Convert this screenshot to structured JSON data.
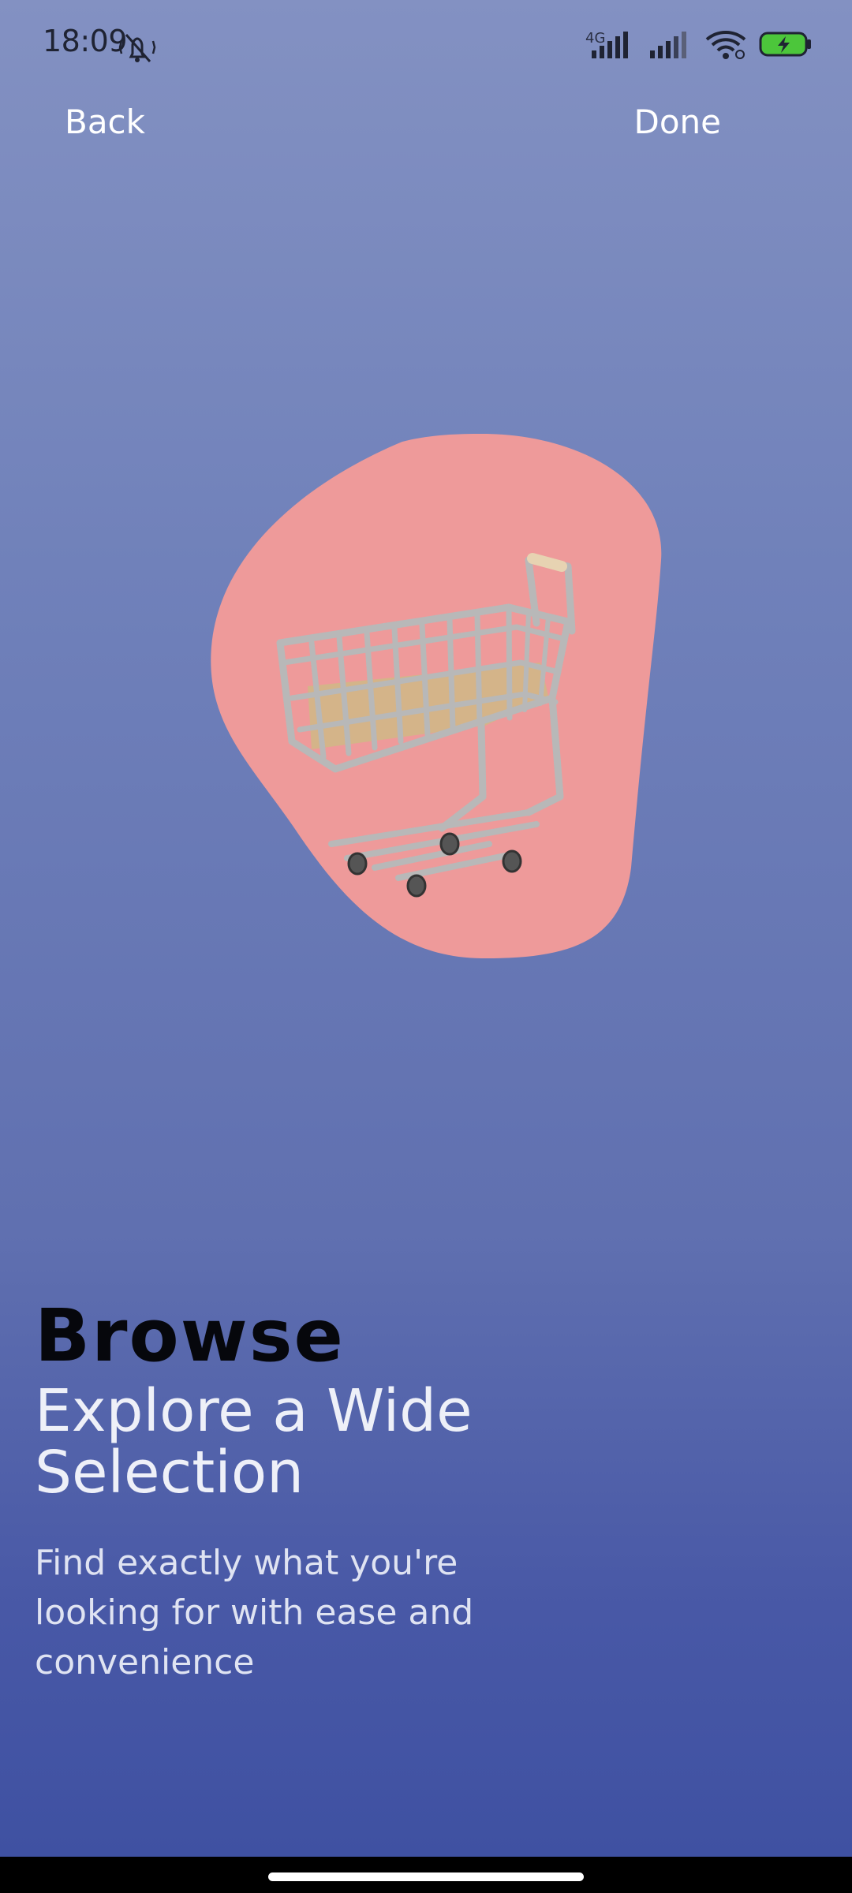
{
  "status_bar": {
    "time": "18:09",
    "network": "4G",
    "icons": [
      "silent-mode-icon",
      "signal-icon",
      "signal-icon",
      "wifi-icon",
      "battery-charging-icon"
    ],
    "battery_color": "#4cc63b"
  },
  "nav": {
    "back_label": "Back",
    "done_label": "Done"
  },
  "illustration": {
    "icon": "shopping-cart-icon",
    "blob_color": "#ee9a9a"
  },
  "content": {
    "eyebrow": "Browse",
    "headline": "Explore a Wide Selection",
    "subtitle": "Find exactly what you're looking for with ease and convenience"
  },
  "colors": {
    "background_top": "#8391c2",
    "background_bottom": "#3f51a2"
  }
}
